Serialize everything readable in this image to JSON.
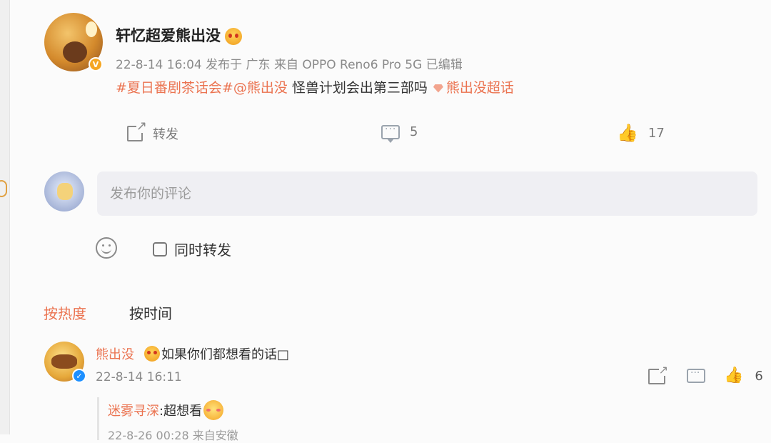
{
  "post": {
    "author": "轩忆超爱熊出没",
    "meta": "22-8-14 16:04  发布于 广东  来自 OPPO Reno6 Pro 5G 已编辑",
    "topic": "#夏日番剧茶话会#",
    "mention": "@熊出没",
    "text": "怪兽计划会出第三部吗",
    "super_topic": "熊出没超话",
    "actions": {
      "forward_label": "转发",
      "comment_count": "5",
      "like_count": "17"
    }
  },
  "composer": {
    "placeholder": "发布你的评论",
    "repost_label": "同时转发"
  },
  "sort_tabs": {
    "hot": "按热度",
    "time": "按时间"
  },
  "comments": [
    {
      "author": "熊出没",
      "text": "如果你们都想看的话□",
      "time": "22-8-14 16:11",
      "like_count": "6",
      "reply": {
        "author": "迷雾寻深",
        "text": ":超想看",
        "time": "22-8-26 00:28 来自安徽"
      }
    }
  ],
  "colors": {
    "accent": "#eb7350",
    "like": "#f0a340",
    "verified_blue": "#1e90ff",
    "verified_gold": "#f5a623"
  },
  "icons": [
    "forward-icon",
    "comment-icon",
    "like-icon",
    "smile-icon",
    "verified-icon",
    "super-topic-icon"
  ]
}
